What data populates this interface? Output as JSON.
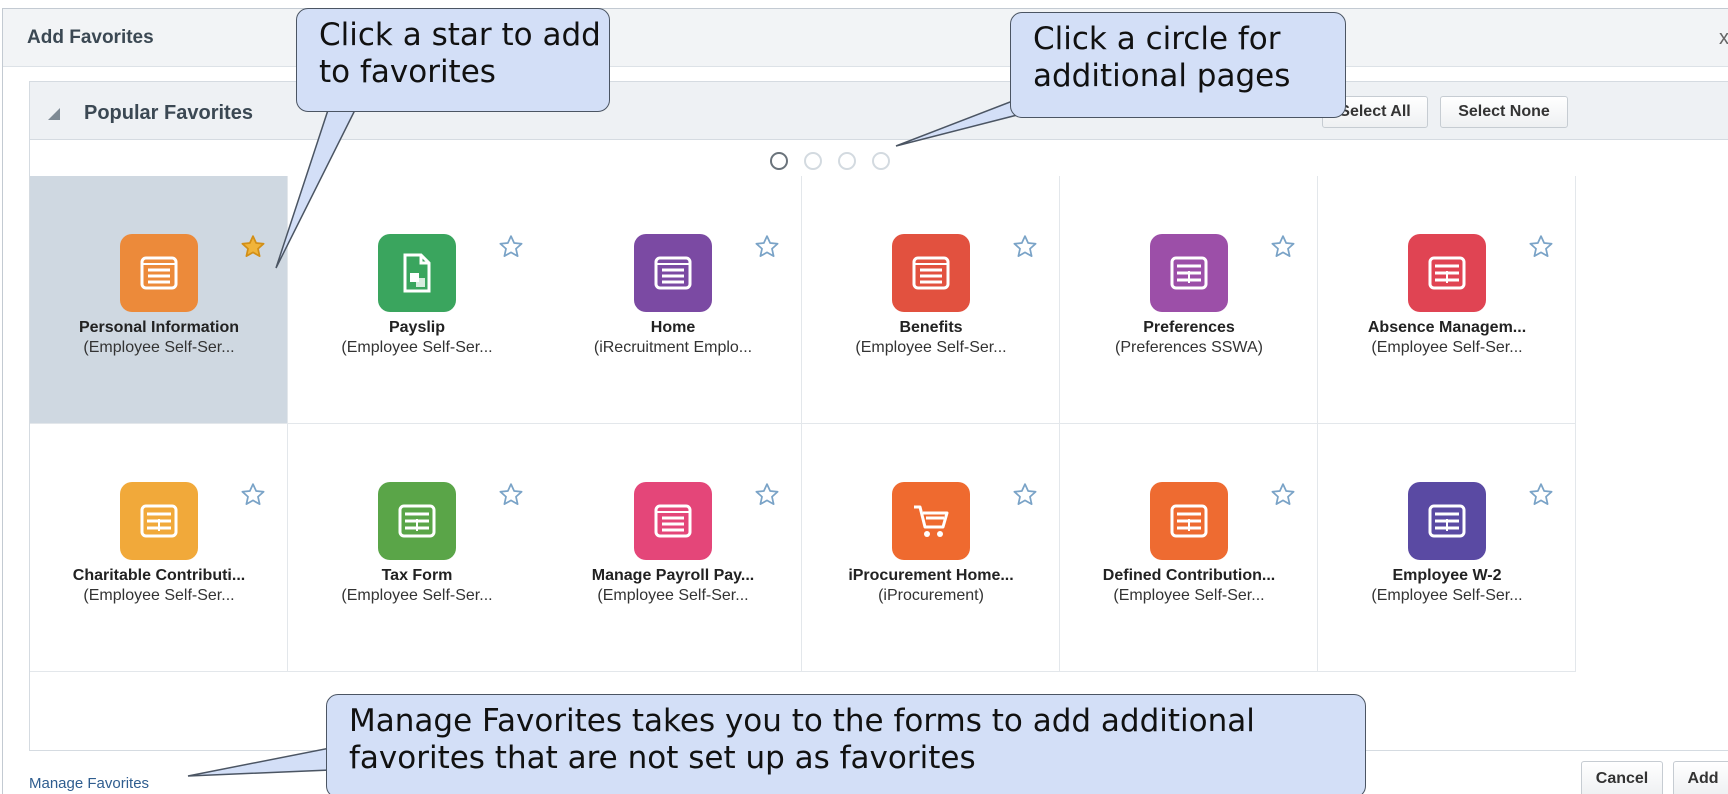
{
  "dialog": {
    "title": "Add Favorites",
    "close": "x"
  },
  "panel": {
    "title": "Popular Favorites",
    "select_all": "Select All",
    "select_none": "Select None"
  },
  "pagination": {
    "pages": 4,
    "active": 1
  },
  "tiles": [
    {
      "name": "Personal Information",
      "sub": "(Employee Self-Ser...",
      "color": "#ec8a3a",
      "icon": "list-icon",
      "selected": true,
      "favorited": true
    },
    {
      "name": "Payslip",
      "sub": "(Employee Self-Ser...",
      "color": "#3aa55e",
      "icon": "document-icon",
      "selected": false,
      "favorited": false
    },
    {
      "name": "Home",
      "sub": "(iRecruitment Emplo...",
      "color": "#7b4aa3",
      "icon": "list-icon",
      "selected": false,
      "favorited": false
    },
    {
      "name": "Benefits",
      "sub": "(Employee Self-Ser...",
      "color": "#e2513f",
      "icon": "list-icon",
      "selected": false,
      "favorited": false
    },
    {
      "name": "Preferences",
      "sub": "(Preferences SSWA)",
      "color": "#9c4fa8",
      "icon": "table-icon",
      "selected": false,
      "favorited": false
    },
    {
      "name": "Absence Managem...",
      "sub": "(Employee Self-Ser...",
      "color": "#e04453",
      "icon": "table-icon",
      "selected": false,
      "favorited": false
    },
    {
      "name": "Charitable Contributi...",
      "sub": "(Employee Self-Ser...",
      "color": "#f1a93a",
      "icon": "table-icon",
      "selected": false,
      "favorited": false
    },
    {
      "name": "Tax Form",
      "sub": "(Employee Self-Ser...",
      "color": "#5aa548",
      "icon": "table-icon",
      "selected": false,
      "favorited": false
    },
    {
      "name": "Manage Payroll Pay...",
      "sub": "(Employee Self-Ser...",
      "color": "#e44679",
      "icon": "list-icon",
      "selected": false,
      "favorited": false
    },
    {
      "name": "iProcurement Home...",
      "sub": "(iProcurement)",
      "color": "#ef6a2f",
      "icon": "cart-icon",
      "selected": false,
      "favorited": false
    },
    {
      "name": "Defined Contribution...",
      "sub": "(Employee Self-Ser...",
      "color": "#ee6b31",
      "icon": "table-icon",
      "selected": false,
      "favorited": false
    },
    {
      "name": "Employee W-2",
      "sub": "(Employee Self-Ser...",
      "color": "#5a4aa3",
      "icon": "table-icon",
      "selected": false,
      "favorited": false
    }
  ],
  "footer": {
    "manage_link": "Manage Favorites",
    "cancel": "Cancel",
    "add": "Add"
  },
  "callouts": {
    "star": "Click a star to add to favorites",
    "circle": "Click a circle for additional pages",
    "manage": "Manage Favorites takes you to the forms to add additional favorites that are not set up as favorites"
  }
}
